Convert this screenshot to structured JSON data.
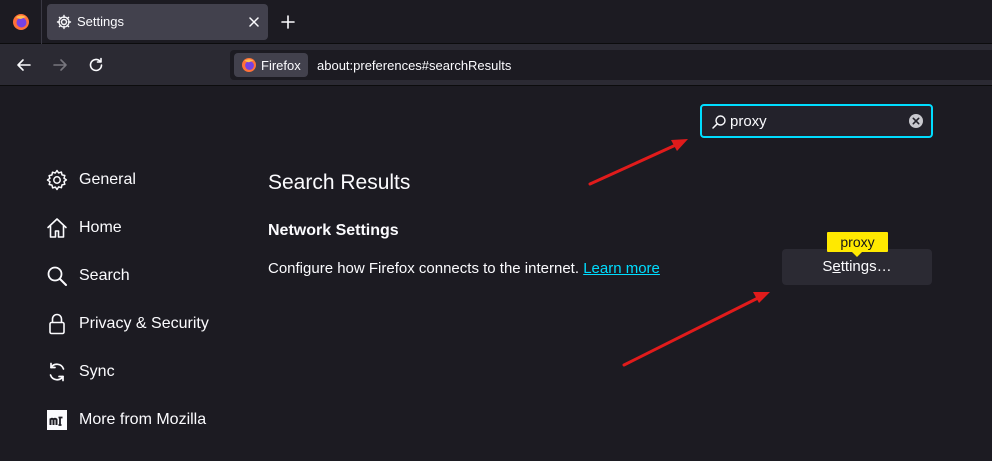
{
  "browser": {
    "tab": {
      "title": "Settings"
    },
    "identity": {
      "label": "Firefox"
    },
    "url": "about:preferences#searchResults"
  },
  "search": {
    "value": "proxy"
  },
  "sidebar": {
    "items": [
      {
        "label": "General",
        "icon": "gear-icon"
      },
      {
        "label": "Home",
        "icon": "home-icon"
      },
      {
        "label": "Search",
        "icon": "search-icon"
      },
      {
        "label": "Privacy & Security",
        "icon": "lock-icon"
      },
      {
        "label": "Sync",
        "icon": "sync-icon"
      },
      {
        "label": "More from Mozilla",
        "icon": "mozilla-icon"
      }
    ]
  },
  "main": {
    "heading": "Search Results",
    "section": {
      "title": "Network Settings",
      "description": "Configure how Firefox connects to the internet.",
      "learn_more": "Learn more"
    },
    "settings_button": {
      "pre": "S",
      "accesskey": "e",
      "post": "ttings…"
    },
    "highlight": "proxy"
  },
  "colors": {
    "accent": "#00ddff",
    "highlight": "#ffe900",
    "annotation_arrow": "#e01b1b"
  }
}
